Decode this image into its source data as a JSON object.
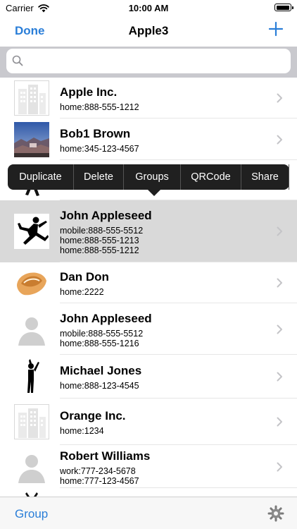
{
  "status_bar": {
    "carrier": "Carrier",
    "time": "10:00 AM",
    "battery_level": 1.0
  },
  "nav_bar": {
    "done_label": "Done",
    "title": "Apple3",
    "add_icon": "plus-icon"
  },
  "search": {
    "value": "",
    "placeholder": "",
    "icon": "search-icon"
  },
  "contacts": [
    {
      "name": "Apple Inc.",
      "phones": [
        "home:888-555-1212"
      ],
      "avatar": "company-placeholder-icon"
    },
    {
      "name": "Bob1 Brown",
      "phones": [
        "home:345-123-4567"
      ],
      "avatar": "landscape-photo"
    },
    {
      "name": "",
      "phones": [],
      "avatar": "runner-silhouette-icon"
    },
    {
      "name": "John Appleseed",
      "phones": [
        "mobile:888-555-5512",
        "home:888-555-1213",
        "home:888-555-1212"
      ],
      "avatar": "jumping-figure-icon",
      "selected": true
    },
    {
      "name": "Dan Don",
      "phones": [
        "home:2222"
      ],
      "avatar": "fortune-cookie-icon"
    },
    {
      "name": "John Appleseed",
      "phones": [
        "mobile:888-555-5512",
        "home:888-555-1216"
      ],
      "avatar": "person-placeholder-icon"
    },
    {
      "name": "Michael Jones",
      "phones": [
        "home:888-123-4545"
      ],
      "avatar": "dancer-silhouette-icon"
    },
    {
      "name": "Orange Inc.",
      "phones": [
        "home:1234"
      ],
      "avatar": "company-placeholder-icon"
    },
    {
      "name": "Robert Williams",
      "phones": [
        "work:777-234-5678",
        "home:777-123-4567"
      ],
      "avatar": "person-placeholder-icon"
    },
    {
      "name": "",
      "phones": [],
      "avatar": "person-silhouette-icon"
    }
  ],
  "context_menu": {
    "items": [
      "Duplicate",
      "Delete",
      "Groups",
      "QRCode",
      "Share"
    ]
  },
  "toolbar": {
    "group_label": "Group",
    "settings_icon": "gear-icon"
  },
  "colors": {
    "accent": "#2a7ed8",
    "search_bar_bg": "#c9c9ce",
    "selected_row": "#d9d9d9",
    "menu_bg": "#202020",
    "toolbar_bg": "#f7f7f7"
  }
}
